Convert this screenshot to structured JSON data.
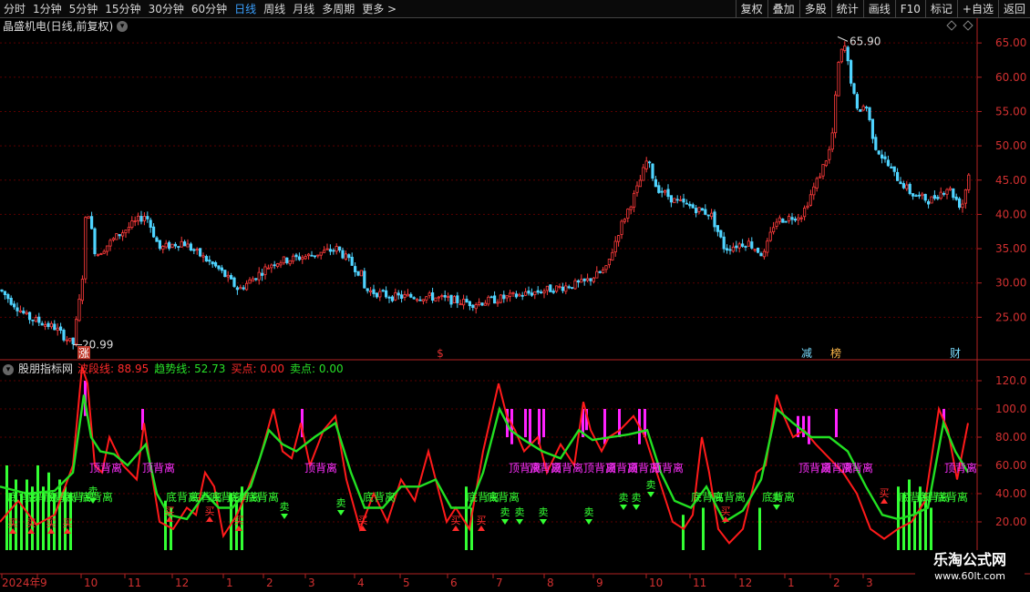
{
  "toolbar": {
    "periods": [
      "分时",
      "1分钟",
      "5分钟",
      "15分钟",
      "30分钟",
      "60分钟",
      "日线",
      "周线",
      "月线",
      "多周期",
      "更多"
    ],
    "active_period": "日线",
    "more_arrow": ">",
    "right_buttons": [
      "复权",
      "叠加",
      "多股",
      "统计",
      "画线",
      "F10",
      "标记",
      "+自选",
      "返回"
    ]
  },
  "main_chart": {
    "title": "晶盛机电(日线,前复权)",
    "high_label": "65.90",
    "low_label": "20.99",
    "y_ticks": [
      "65.00",
      "60.00",
      "55.00",
      "50.00",
      "45.00",
      "40.00",
      "35.00",
      "30.00",
      "25.00"
    ],
    "markers": [
      "涨",
      "$",
      "减",
      "榜",
      "财"
    ],
    "colors": {
      "up": "#ff3b3b",
      "down": "#4fd4ff",
      "axis": "#b22222",
      "grid": "#5a0000"
    }
  },
  "indicator": {
    "name": "股朋指标网",
    "values": [
      {
        "label": "波段线: 88.95",
        "color": "#ff2a2a"
      },
      {
        "label": "趋势线: 52.73",
        "color": "#28e028"
      },
      {
        "label": "买点: 0.00",
        "color": "#ff2a2a"
      },
      {
        "label": "卖点: 0.00",
        "color": "#28e028"
      }
    ],
    "y_ticks": [
      "120.0",
      "100.0",
      "80.00",
      "60.00",
      "40.00",
      "20.00"
    ],
    "labels": {
      "top_div": "顶背离",
      "bottom_div": "底背离",
      "buy": "买",
      "sell": "卖"
    },
    "colors": {
      "wave": "#ff1a1a",
      "trend": "#22e022",
      "top_bar": "#ff22ff",
      "bottom_bar": "#33ff33"
    }
  },
  "date_axis": [
    "2024年",
    "9",
    "10",
    "11",
    "12",
    "1",
    "2",
    "3",
    "4",
    "5",
    "6",
    "7",
    "8",
    "9",
    "10",
    "11",
    "12",
    "1",
    "2",
    "3"
  ],
  "watermark": {
    "title": "乐淘公式网",
    "url": "www.60lt.com"
  }
}
